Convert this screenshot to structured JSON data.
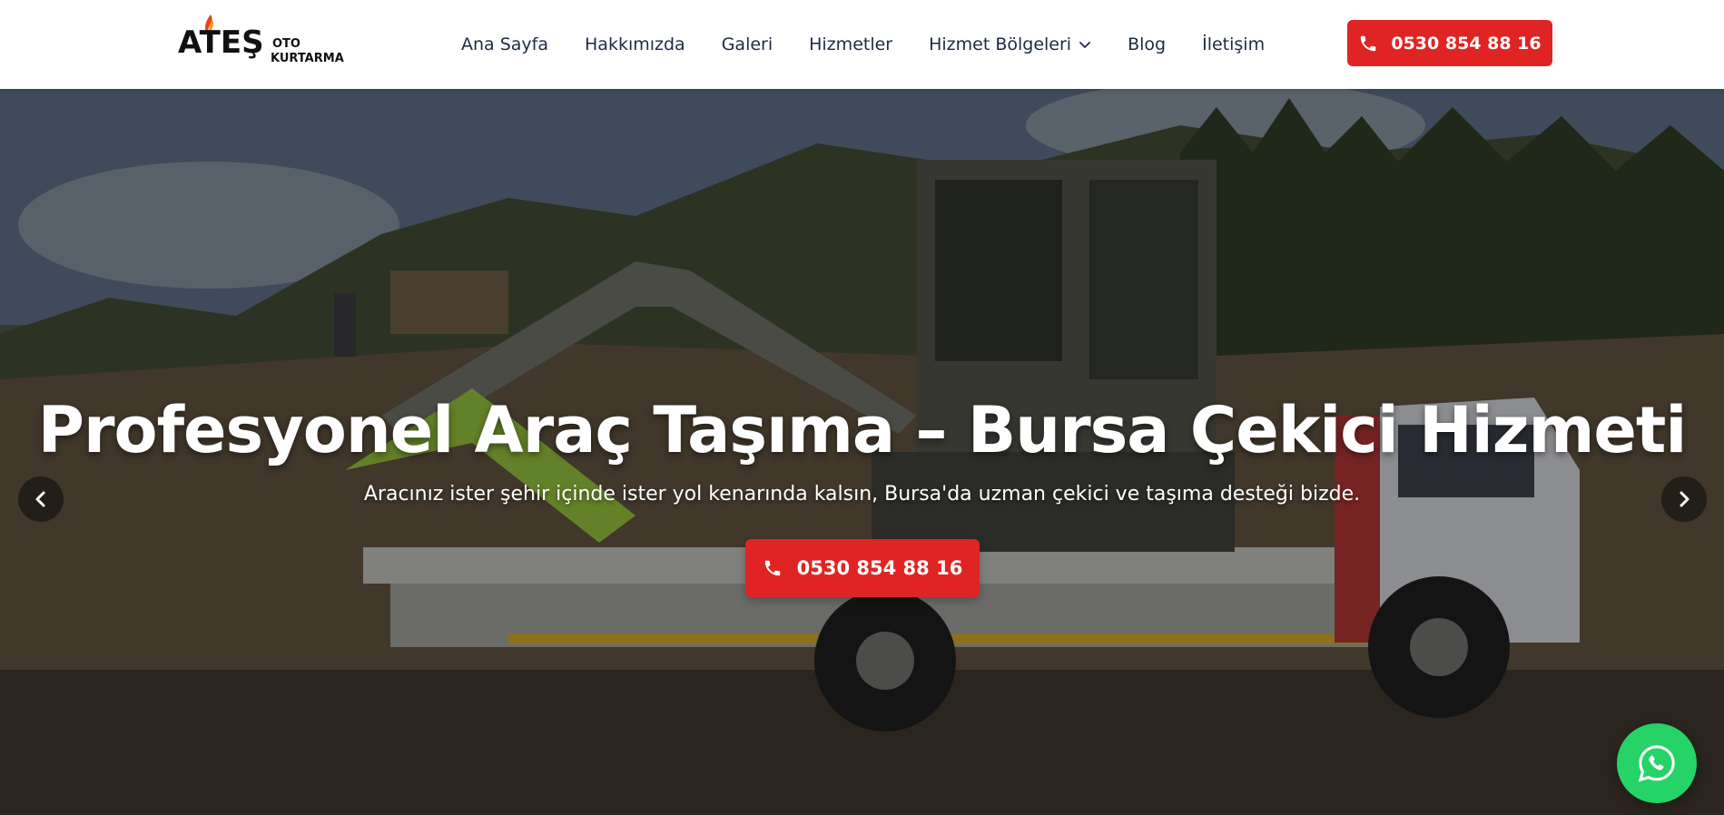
{
  "header": {
    "logo": {
      "primary_text": "ATEŞ",
      "secondary_text_1": "OTO",
      "secondary_text_2": "KURTARMA",
      "icon": "flame-icon"
    },
    "nav": [
      {
        "label": "Ana Sayfa"
      },
      {
        "label": "Hakkımızda"
      },
      {
        "label": "Galeri"
      },
      {
        "label": "Hizmetler"
      },
      {
        "label": "Hizmet Bölgeleri",
        "has_dropdown": true
      },
      {
        "label": "Blog"
      },
      {
        "label": "İletişim"
      }
    ],
    "cta_phone": "0530 854 88 16"
  },
  "hero": {
    "title": "Profesyonel Araç Taşıma – Bursa Çekici Hizmeti",
    "subtitle": "Aracınız ister şehir içinde ister yol kenarında kalsın, Bursa'da uzman çekici ve taşıma desteği bizde.",
    "cta_phone": "0530 854 88 16",
    "prev_icon": "chevron-left-icon",
    "next_icon": "chevron-right-icon"
  },
  "floating": {
    "whatsapp_icon": "whatsapp-icon"
  },
  "colors": {
    "accent_red": "#e02424",
    "nav_text": "#1e2a44",
    "whatsapp_green": "#25d366"
  }
}
